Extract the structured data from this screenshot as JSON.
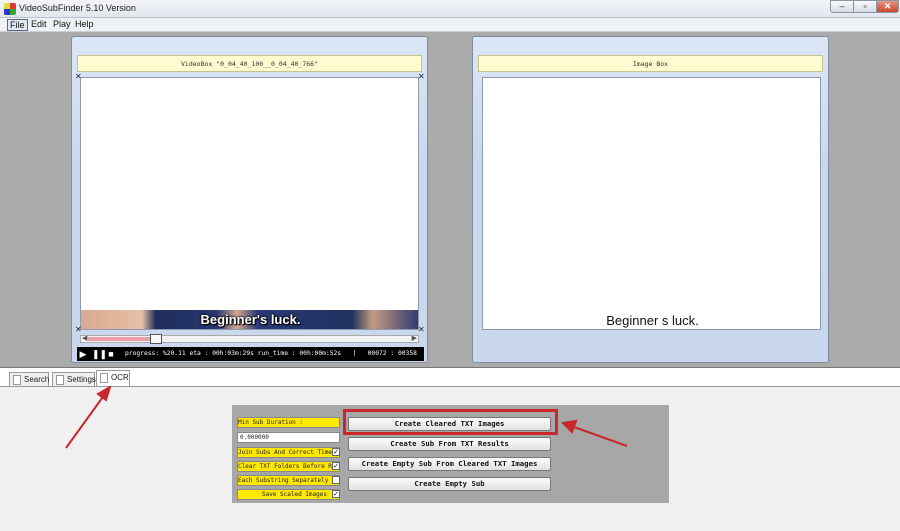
{
  "window": {
    "title": "VideoSubFinder 5.10 Version",
    "minimize": "–",
    "maximize": "▫",
    "close": "✕"
  },
  "menu": {
    "file": "File",
    "edit": "Edit",
    "play": "Play",
    "help": "Help"
  },
  "video_box": {
    "title": "VideoBox \"0_04_40_100__0_04_40_766\"",
    "subtitle": "Beginner's luck.",
    "progress_text": "progress: %20.11 eta : 00h:03m:29s run_time : 00h:00m:52s   |   00072 : 00358",
    "slider_position_fraction": 0.2
  },
  "image_box": {
    "title": "Image Box",
    "subtitle": "Beginner s luck."
  },
  "tabs": {
    "search": "Search",
    "settings": "Settings",
    "ocr": "OCR"
  },
  "ocr": {
    "min_sub_duration_label": "Min Sub Duration :",
    "min_sub_duration_value": "0.000000",
    "join_subs_label": "Join Subs And Correct Time",
    "join_subs_checked": "✓",
    "clear_txt_label": "Clear TXT Folders Before Run",
    "clear_txt_checked": "✓",
    "each_substring_label": "Each Substring Separately",
    "each_substring_checked": "",
    "save_scaled_label": "Save Scaled Images",
    "save_scaled_checked": "✓",
    "buttons": {
      "create_cleared": "Create Cleared TXT Images",
      "create_sub_from_txt": "Create Sub From TXT Results",
      "create_empty_from_cleared": "Create Empty Sub From Cleared TXT Images",
      "create_empty": "Create Empty Sub"
    }
  },
  "annotation": {
    "color": "#c8282c"
  }
}
